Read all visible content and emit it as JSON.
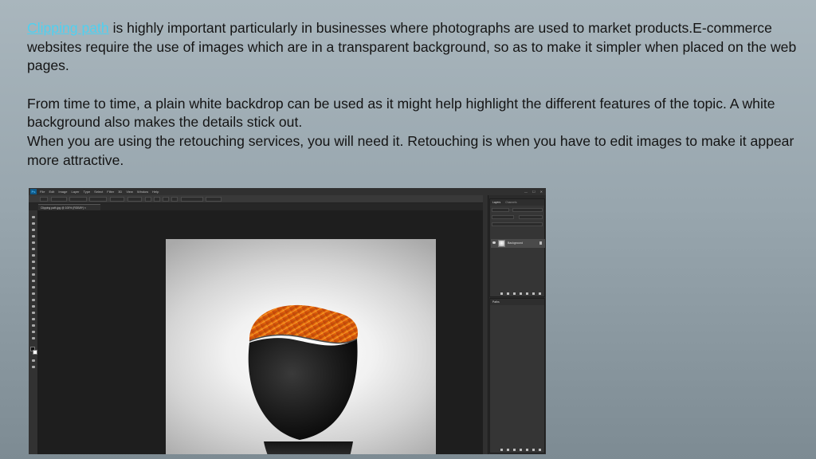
{
  "article": {
    "link_text": "Clipping path",
    "p1_rest": " is highly important particularly in businesses where photographs are used to market products.E-commerce websites require the use of images which are in a transparent background, so as to make it simpler when placed on the web pages.",
    "p2": "From time to time, a plain white backdrop can be used as it might help highlight the different features of the topic. A white background also makes the details stick out.",
    "p3": "When you are using the retouching services, you will need it. Retouching is when you have to edit images to make it appear more attractive.",
    "link_color": "#4fd0f0"
  },
  "photoshop": {
    "logo": "Ps",
    "menus": [
      "File",
      "Edit",
      "Image",
      "Layer",
      "Type",
      "Select",
      "Filter",
      "3D",
      "View",
      "Window",
      "Help"
    ],
    "window_controls": [
      "—",
      "☐",
      "✕"
    ],
    "document_tab": "Clipping path.jpg @ 100% (RGB/8*) ×",
    "panel_tabs": {
      "layers": "Layers",
      "channels": "Channels",
      "paths": "Paths"
    },
    "layer_name": "Background",
    "icons": [
      "move-tool",
      "marquee-tool",
      "lasso-tool",
      "quick-select-tool",
      "crop-tool",
      "eyedropper-tool",
      "healing-tool",
      "brush-tool",
      "stamp-tool",
      "history-brush-tool",
      "eraser-tool",
      "gradient-tool",
      "blur-tool",
      "dodge-tool",
      "pen-tool",
      "type-tool",
      "path-select-tool",
      "shape-tool",
      "hand-tool",
      "zoom-tool"
    ],
    "colors": {
      "canvas": "#1e1e1e",
      "panel": "#353535",
      "bowl_outer": "#141414",
      "bowl_inner": "#e8650a"
    }
  }
}
